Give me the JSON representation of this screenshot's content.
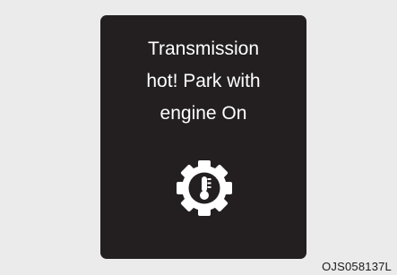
{
  "display": {
    "background_color": "#231f20",
    "text_color": "#ffffff",
    "message_lines": [
      "Transmission",
      "hot! Park with",
      "engine On"
    ],
    "icon": "transmission-temperature-warning-icon"
  },
  "page": {
    "background_color": "#ebebeb",
    "image_code": "OJS058137L"
  }
}
